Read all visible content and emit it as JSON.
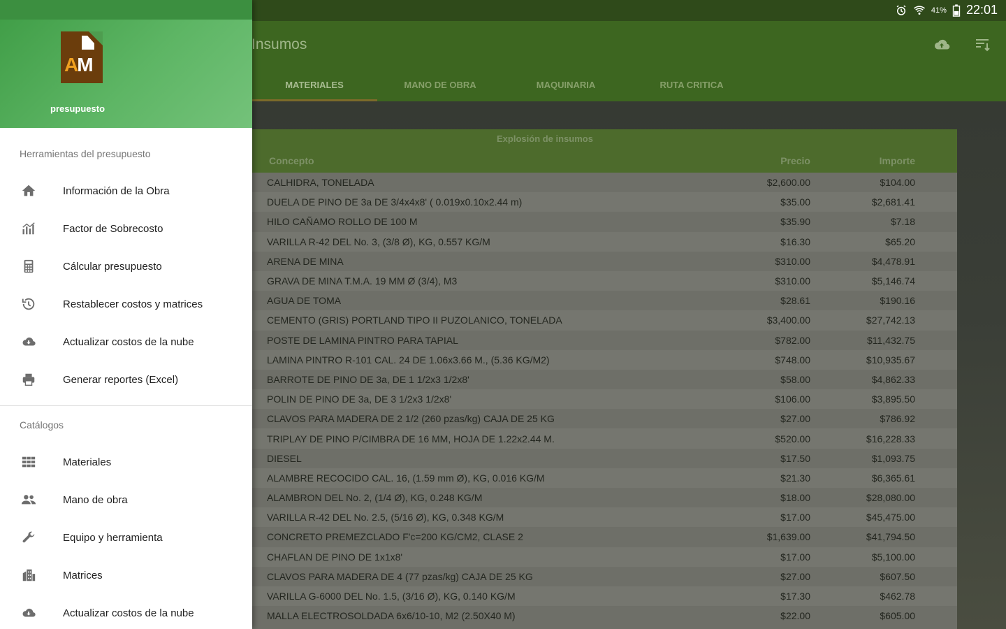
{
  "status_bar": {
    "time": "22:01",
    "battery": "41%"
  },
  "app_bar": {
    "title": "Insumos",
    "tabs": [
      {
        "label": "MATERIALES",
        "active": true
      },
      {
        "label": "MANO DE OBRA",
        "active": false
      },
      {
        "label": "MAQUINARIA",
        "active": false
      },
      {
        "label": "RUTA CRITICA",
        "active": false
      }
    ],
    "actions": [
      {
        "icon": "cloud-upload-icon"
      },
      {
        "icon": "sort-icon"
      }
    ]
  },
  "table": {
    "caption": "Explosión de insumos",
    "headers": {
      "concept": "Concepto",
      "price": "Precio",
      "amount": "Importe"
    },
    "rows": [
      {
        "concept": "CALHIDRA, TONELADA",
        "price": "$2,600.00",
        "amount": "$104.00"
      },
      {
        "concept": "DUELA DE PINO DE 3a DE 3/4x4x8' ( 0.019x0.10x2.44 m)",
        "price": "$35.00",
        "amount": "$2,681.41"
      },
      {
        "concept": "HILO CAÑAMO ROLLO DE 100 M",
        "price": "$35.90",
        "amount": "$7.18"
      },
      {
        "concept": "VARILLA R-42 DEL No. 3, (3/8 Ø), KG, 0.557 KG/M",
        "price": "$16.30",
        "amount": "$65.20"
      },
      {
        "concept": "ARENA DE MINA",
        "price": "$310.00",
        "amount": "$4,478.91"
      },
      {
        "concept": "GRAVA DE MINA T.M.A. 19 MM Ø (3/4), M3",
        "price": "$310.00",
        "amount": "$5,146.74"
      },
      {
        "concept": "AGUA DE TOMA",
        "price": "$28.61",
        "amount": "$190.16"
      },
      {
        "concept": "CEMENTO (GRIS) PORTLAND TIPO II PUZOLANICO, TONELADA",
        "price": "$3,400.00",
        "amount": "$27,742.13"
      },
      {
        "concept": "POSTE DE LAMINA PINTRO PARA TAPIAL",
        "price": "$782.00",
        "amount": "$11,432.75"
      },
      {
        "concept": "LAMINA PINTRO R-101 CAL. 24 DE 1.06x3.66 M., (5.36 KG/M2)",
        "price": "$748.00",
        "amount": "$10,935.67"
      },
      {
        "concept": "BARROTE DE PINO DE 3a, DE 1 1/2x3 1/2x8'",
        "price": "$58.00",
        "amount": "$4,862.33"
      },
      {
        "concept": "POLIN DE PINO DE 3a, DE 3 1/2x3 1/2x8'",
        "price": "$106.00",
        "amount": "$3,895.50"
      },
      {
        "concept": "CLAVOS PARA MADERA DE 2 1/2 (260 pzas/kg) CAJA DE 25 KG",
        "price": "$27.00",
        "amount": "$786.92"
      },
      {
        "concept": "TRIPLAY DE PINO P/CIMBRA DE 16 MM, HOJA DE 1.22x2.44 M.",
        "price": "$520.00",
        "amount": "$16,228.33"
      },
      {
        "concept": "DIESEL",
        "price": "$17.50",
        "amount": "$1,093.75"
      },
      {
        "concept": "ALAMBRE RECOCIDO CAL. 16, (1.59 mm Ø), KG, 0.016 KG/M",
        "price": "$21.30",
        "amount": "$6,365.61"
      },
      {
        "concept": "ALAMBRON DEL No. 2, (1/4 Ø), KG, 0.248 KG/M",
        "price": "$18.00",
        "amount": "$28,080.00"
      },
      {
        "concept": "VARILLA R-42 DEL No. 2.5, (5/16 Ø), KG, 0.348 KG/M",
        "price": "$17.00",
        "amount": "$45,475.00"
      },
      {
        "concept": "CONCRETO PREMEZCLADO F'c=200 KG/CM2, CLASE 2",
        "price": "$1,639.00",
        "amount": "$41,794.50"
      },
      {
        "concept": "CHAFLAN DE PINO DE 1x1x8'",
        "price": "$17.00",
        "amount": "$5,100.00"
      },
      {
        "concept": "CLAVOS PARA MADERA DE 4 (77 pzas/kg) CAJA DE 25 KG",
        "price": "$27.00",
        "amount": "$607.50"
      },
      {
        "concept": "VARILLA G-6000 DEL No. 1.5, (3/16 Ø), KG, 0.140 KG/M",
        "price": "$17.30",
        "amount": "$462.78"
      },
      {
        "concept": "MALLA ELECTROSOLDADA 6x6/10-10, M2 (2.50X40 M)",
        "price": "$22.00",
        "amount": "$605.00"
      }
    ]
  },
  "drawer": {
    "app_name": "presupuesto",
    "logo_text": {
      "a": "A",
      "m": "M"
    },
    "section_tools": "Herramientas del presupuesto",
    "tools": [
      {
        "label": "Información de la Obra",
        "icon": "home-icon"
      },
      {
        "label": "Factor de Sobrecosto",
        "icon": "chart-icon"
      },
      {
        "label": "Cálcular presupuesto",
        "icon": "calculator-icon"
      },
      {
        "label": "Restablecer costos y matrices",
        "icon": "restore-icon"
      },
      {
        "label": "Actualizar costos de la nube",
        "icon": "cloud-icon"
      },
      {
        "label": "Generar reportes (Excel)",
        "icon": "print-icon"
      }
    ],
    "section_catalogs": "Catálogos",
    "catalogs": [
      {
        "label": "Materiales",
        "icon": "grid-icon"
      },
      {
        "label": "Mano de obra",
        "icon": "people-icon"
      },
      {
        "label": "Equipo y herramienta",
        "icon": "wrench-icon"
      },
      {
        "label": "Matrices",
        "icon": "building-icon"
      },
      {
        "label": "Actualizar costos de la nube",
        "icon": "cloud-icon"
      }
    ]
  }
}
